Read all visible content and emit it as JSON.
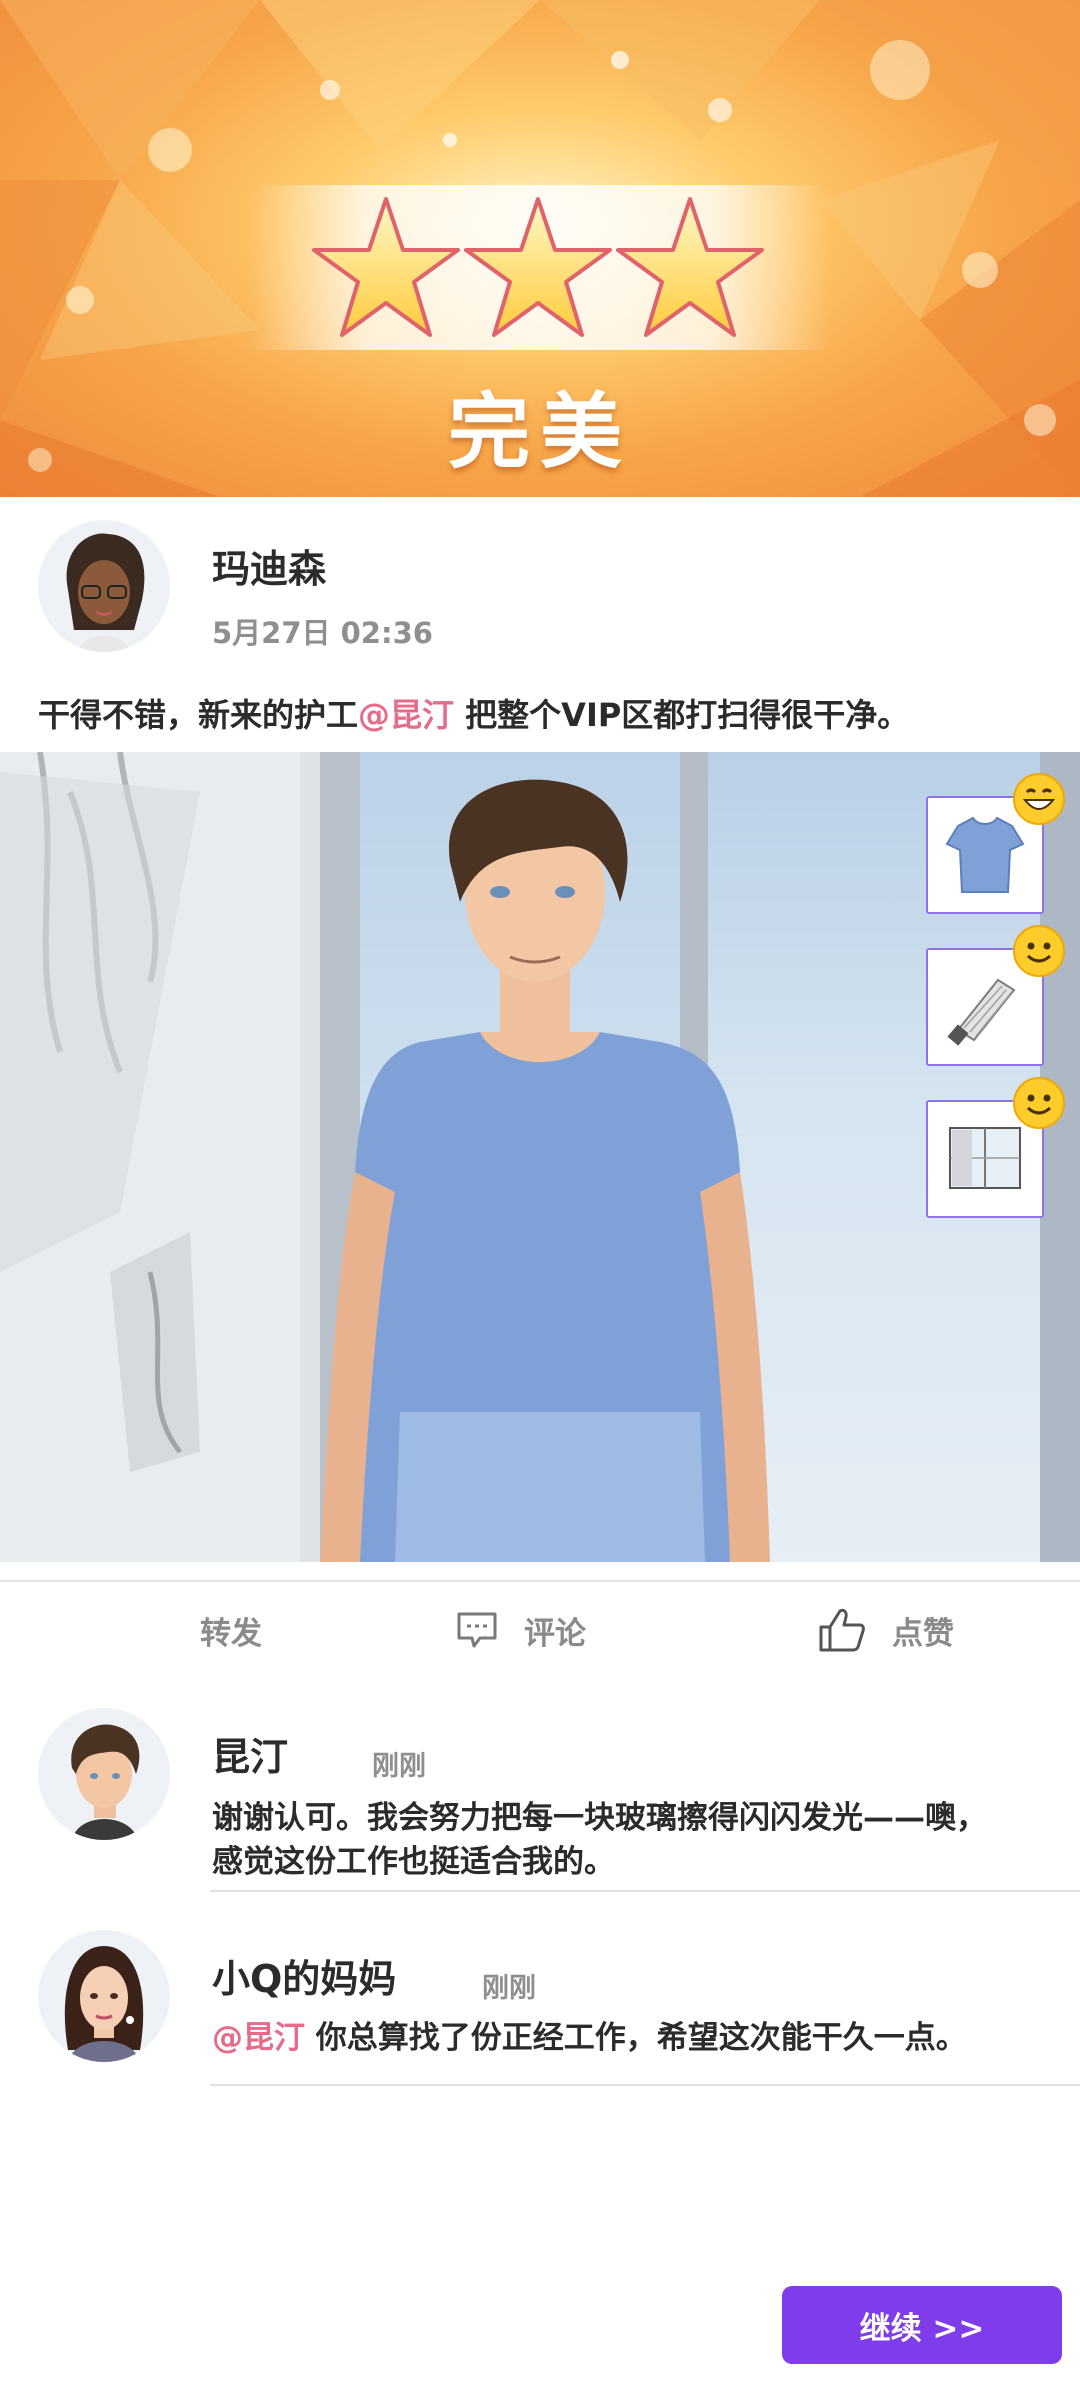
{
  "banner": {
    "stars_earned": 3,
    "stars_total": 3,
    "rating_label": "完美"
  },
  "post": {
    "author": "玛迪森",
    "time": "5月27日 02:36",
    "text_before": "干得不错，新来的护工",
    "mention": "@昆汀",
    "text_after": " 把整个VIP区都打扫得很干净。"
  },
  "scene": {
    "items": [
      {
        "icon": "t-shirt-icon",
        "reaction": "grin-emoji-icon"
      },
      {
        "icon": "squeegee-icon",
        "reaction": "smile-emoji-icon"
      },
      {
        "icon": "window-background-icon",
        "reaction": "smile-emoji-icon"
      }
    ]
  },
  "actions": {
    "share_label": "转发",
    "comment_label": "评论",
    "like_label": "点赞"
  },
  "comments": [
    {
      "author": "昆汀",
      "time": "刚刚",
      "text": "谢谢认可。我会努力把每一块玻璃擦得闪闪发光——噢，感觉这份工作也挺适合我的。"
    },
    {
      "author": "小Q的妈妈",
      "time": "刚刚",
      "mention": "@昆汀",
      "text": " 你总算找了份正经工作，希望这次能干久一点。"
    }
  ],
  "continue_label": "继续 >>",
  "colors": {
    "accent": "#7e3cea",
    "mention": "#e66b8a",
    "item_border": "#8d72e8"
  }
}
